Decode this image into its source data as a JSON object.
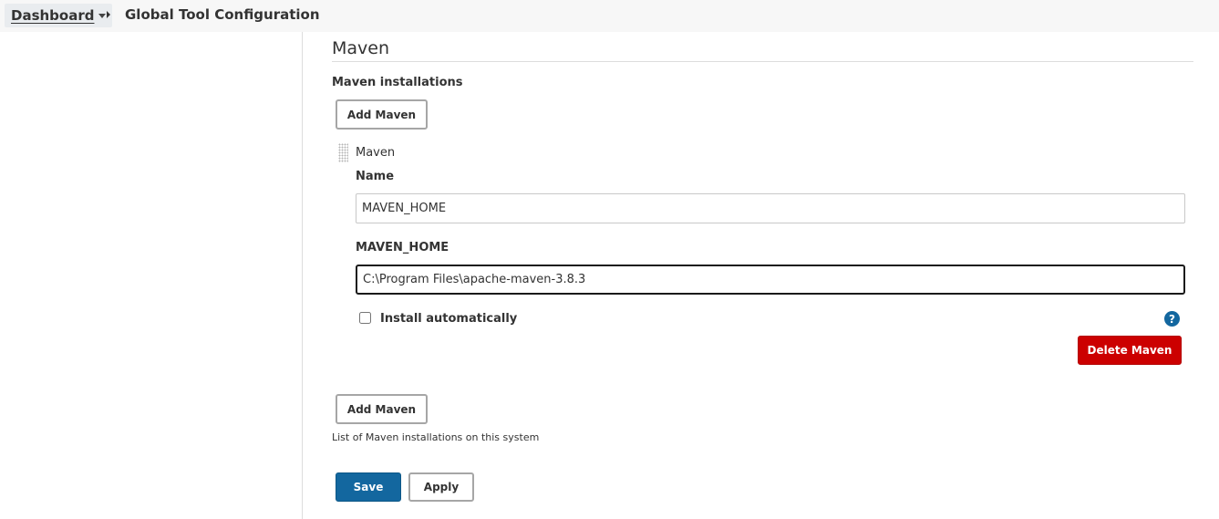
{
  "breadcrumb": {
    "root_label": "Dashboard",
    "current_label": "Global Tool Configuration"
  },
  "section": {
    "title": "Maven",
    "installations_label": "Maven installations",
    "add_button_label": "Add Maven",
    "description": "List of Maven installations on this system"
  },
  "installation": {
    "header_label": "Maven",
    "name_label": "Name",
    "name_value": "MAVEN_HOME",
    "home_label": "MAVEN_HOME",
    "home_value": "C:\\Program Files\\apache-maven-3.8.3",
    "install_auto_label": "Install automatically",
    "install_auto_checked": false,
    "help_glyph": "?",
    "delete_button_label": "Delete Maven"
  },
  "footer": {
    "save_label": "Save",
    "apply_label": "Apply"
  },
  "colors": {
    "primary": "#13679f",
    "danger": "#cc0000",
    "breadcrumb_bg": "#f7f7f7"
  },
  "icons": {
    "breadcrumb_dropdown": "chevron-down-icon",
    "breadcrumb_separator": "chevron-right-icon",
    "drag_handle": "drag-handle-icon",
    "help": "help-icon"
  }
}
